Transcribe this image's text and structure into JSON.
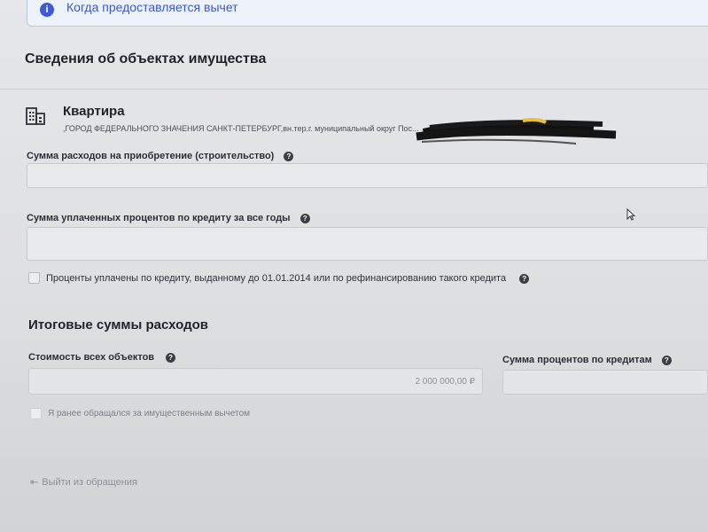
{
  "banner": {
    "icon": "info-icon",
    "text": "Когда предоставляется вычет"
  },
  "section": {
    "title": "Сведения об объектах имущества"
  },
  "property": {
    "icon": "building-icon",
    "title": "Квартира",
    "address": ",ГОРОД ФЕДЕРАЛЬНОГО ЗНАЧЕНИЯ САНКТ-ПЕТЕРБУРГ,вн.тер.г. муниципальный округ Пос..."
  },
  "fields": {
    "purchase_cost": {
      "label": "Сумма расходов на приобретение (строительство)",
      "value": ""
    },
    "interest_paid": {
      "label": "Сумма уплаченных процентов по кредиту за все годы",
      "value": ""
    }
  },
  "checkbox_pre2014": {
    "label": "Проценты уплачены по кредиту, выданному до 01.01.2014 или по рефинансированию такого кредита",
    "checked": false
  },
  "totals": {
    "title": "Итоговые суммы расходов",
    "objects_cost": {
      "label": "Стоимость всех объектов",
      "value": "2 000 000,00 ₽"
    },
    "credit_interest": {
      "label": "Сумма процентов по кредитам",
      "value": ""
    }
  },
  "checkbox_previous": {
    "label": "Я ранее обращался за имущественным вычетом",
    "checked": false
  },
  "exit": {
    "icon": "exit-icon",
    "label": "Выйти из обращения"
  },
  "help_glyph": "?",
  "info_glyph": "i"
}
